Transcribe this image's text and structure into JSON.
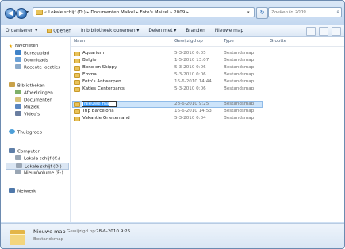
{
  "address": {
    "crumbs": [
      "Lokale schijf (D:)",
      "Documenten Maikel",
      "Foto's Maikel",
      "2009"
    ]
  },
  "search": {
    "placeholder": "Zoeken in 2009"
  },
  "toolbar": {
    "organize": "Organiseren",
    "open": "Openen",
    "include_library": "In bibliotheek opnemen",
    "share": "Delen met",
    "burn": "Branden",
    "new_folder": "Nieuwe map"
  },
  "nav": {
    "favorites": "Favorieten",
    "desktop": "Bureaublad",
    "downloads": "Downloads",
    "recent": "Recente locaties",
    "libraries": "Bibliotheken",
    "pictures": "Afbeeldingen",
    "documents": "Documenten",
    "music": "Muziek",
    "videos": "Video's",
    "homegroup": "Thuisgroep",
    "computer": "Computer",
    "drive_c": "Lokale schijf (C:)",
    "drive_d": "Lokale schijf (D:)",
    "drive_e": "NieuwVolume (E:)",
    "network": "Netwerk"
  },
  "columns": {
    "name": "Naam",
    "modified": "Gewijzigd op",
    "type": "Type",
    "size": "Grootte"
  },
  "files": [
    {
      "name": "Aquarium",
      "modified": "5-3-2010 0:05",
      "type": "Bestandsmap"
    },
    {
      "name": "Belgie",
      "modified": "1-5-2010 13:07",
      "type": "Bestandsmap"
    },
    {
      "name": "Bono en Skippy",
      "modified": "5-3-2010 0:06",
      "type": "Bestandsmap"
    },
    {
      "name": "Emma",
      "modified": "5-3-2010 0:06",
      "type": "Bestandsmap"
    },
    {
      "name": "Foto's Antwerpen",
      "modified": "16-6-2010 14:44",
      "type": "Bestandsmap"
    },
    {
      "name": "Katjes Centerparcs",
      "modified": "5-3-2010 0:06",
      "type": "Bestandsmap"
    },
    {
      "name": "Nieuwe map",
      "modified": "28-6-2010 9:25",
      "type": "Bestandsmap"
    },
    {
      "name": "Trip Barcelona",
      "modified": "16-6-2010 14:53",
      "type": "Bestandsmap"
    },
    {
      "name": "Vakantie Griekenland",
      "modified": "5-3-2010 0:04",
      "type": "Bestandsmap"
    }
  ],
  "details": {
    "name": "Nieuwe map",
    "modified_label": "Gewijzigd op:",
    "modified_value": "28-6-2010 9:25",
    "type": "Bestandsmap"
  }
}
